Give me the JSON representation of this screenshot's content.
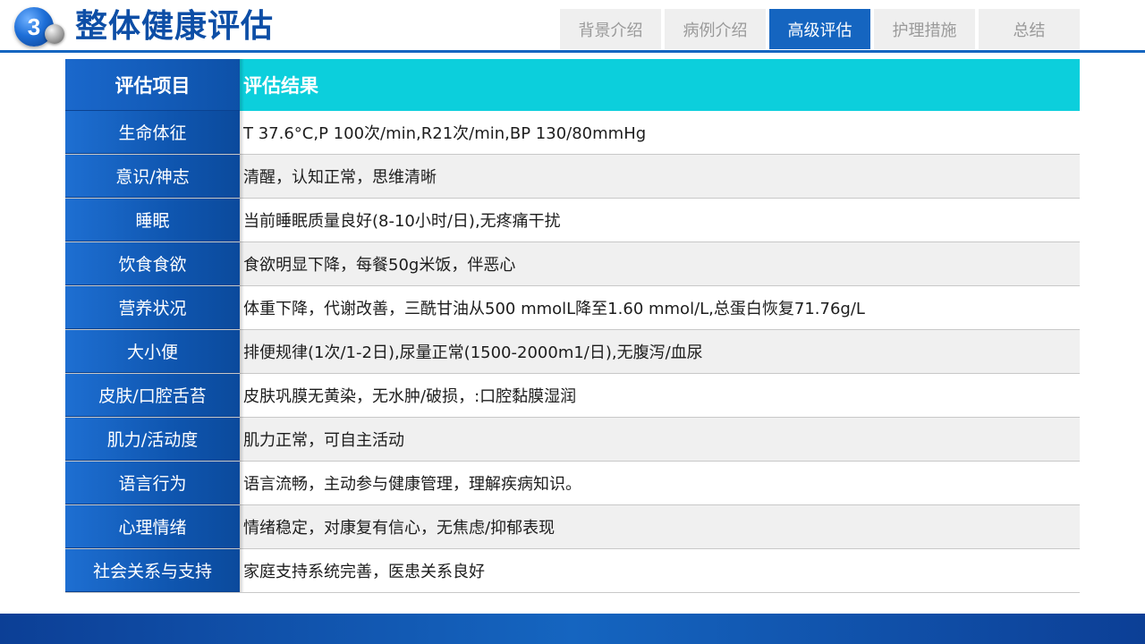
{
  "header": {
    "section_number": "3",
    "title": "整体健康评估"
  },
  "nav": {
    "tabs": [
      {
        "label": "背景介绍",
        "active": false
      },
      {
        "label": "病例介绍",
        "active": false
      },
      {
        "label": "高级评估",
        "active": true
      },
      {
        "label": "护理措施",
        "active": false
      },
      {
        "label": "总结",
        "active": false
      }
    ]
  },
  "table": {
    "headers": {
      "item": "评估项目",
      "result": "评估结果"
    },
    "rows": [
      {
        "item": "生命体征",
        "result": "T 37.6°C,P 100次/min,R21次/min,BP 130/80mmHg"
      },
      {
        "item": "意识/神志",
        "result": "清醒，认知正常，思维清晰"
      },
      {
        "item": "睡眠",
        "result": "当前睡眠质量良好(8-10小时/日),无疼痛干扰"
      },
      {
        "item": "饮食食欲",
        "result": "食欲明显下降，每餐50g米饭，伴恶心"
      },
      {
        "item": "营养状况",
        "result": "体重下降，代谢改善，三酰甘油从500 mmolL降至1.60 mmol/L,总蛋白恢复71.76g/L"
      },
      {
        "item": "大小便",
        "result": "排便规律(1次/1-2日),尿量正常(1500-2000m1/日),无腹泻/血尿"
      },
      {
        "item": "皮肤/口腔舌苔",
        "result": "皮肤巩膜无黄染，无水肿/破损，:口腔黏膜湿润"
      },
      {
        "item": "肌力/活动度",
        "result": "肌力正常，可自主活动"
      },
      {
        "item": "语言行为",
        "result": "语言流畅，主动参与健康管理，理解疾病知识。"
      },
      {
        "item": "心理情绪",
        "result": "情绪稳定，对康复有信心，无焦虑/抑郁表现"
      },
      {
        "item": "社会关系与支持",
        "result": "家庭支持系统完善，医患关系良好"
      }
    ]
  },
  "colors": {
    "primary_blue": "#1565c0",
    "header_cyan": "#0ccfdc",
    "title_blue": "#0d4ea6"
  }
}
